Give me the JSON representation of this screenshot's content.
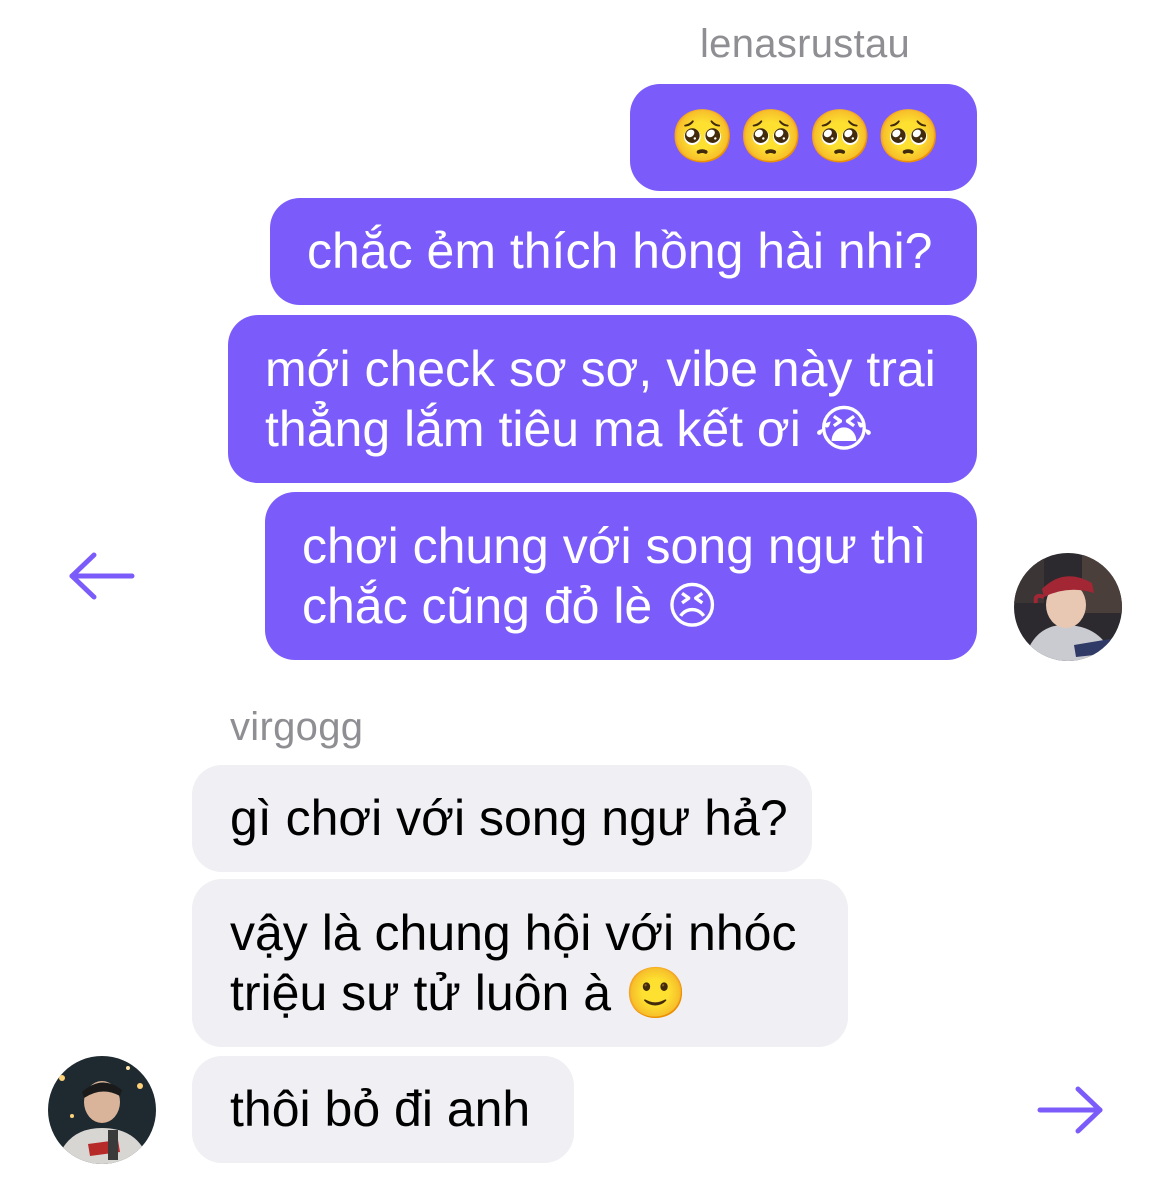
{
  "outgoing": {
    "sender_name": "lenasrustau",
    "messages": [
      {
        "text": "🥺🥺🥺🥺"
      },
      {
        "text": "chắc ẻm thích hồng hài nhi?"
      },
      {
        "line1": "mới check sơ sơ, vibe này trai",
        "line2": "thẳng lắm tiêu ma kết ơi 😭"
      },
      {
        "line1": "chơi chung với song ngư thì",
        "line2": "chắc cũng đỏ lè 😣"
      }
    ]
  },
  "incoming": {
    "sender_name": "virgogg",
    "messages": [
      {
        "text": "gì chơi với song ngư hả?"
      },
      {
        "line1": "vậy là chung hội với nhóc",
        "line2": "triệu sư tử luôn à 🙂"
      },
      {
        "text": "thôi bỏ đi anh"
      }
    ]
  },
  "icons": {
    "left_arrow": "arrow-left-icon",
    "right_arrow": "arrow-right-icon"
  },
  "colors": {
    "outgoing_bubble": "#7b5cfa",
    "incoming_bubble": "#efeff4",
    "arrow": "#7b5cfa",
    "sender_name": "#8e8e93"
  }
}
